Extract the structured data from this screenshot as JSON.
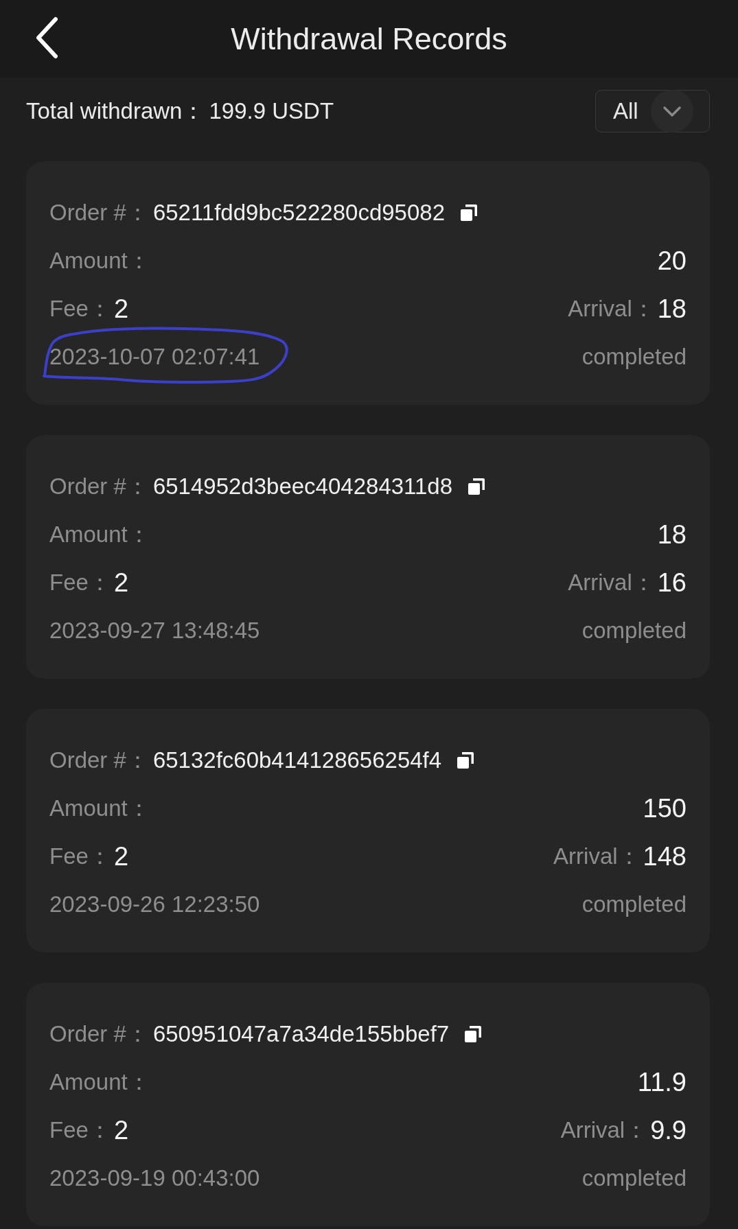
{
  "header": {
    "title": "Withdrawal Records"
  },
  "summary": {
    "label": "Total withdrawn：",
    "value": "199.9 USDT"
  },
  "filter": {
    "value": "All"
  },
  "records": [
    {
      "order_label": "Order #：",
      "order_no": "65211fdd9bc522280cd95082",
      "amount_label": "Amount：",
      "amount": "20",
      "fee_label": "Fee：",
      "fee": "2",
      "arrival_label": "Arrival：",
      "arrival": "18",
      "time": "2023-10-07 02:07:41",
      "status": "completed",
      "circled": true
    },
    {
      "order_label": "Order #：",
      "order_no": "6514952d3beec404284311d8",
      "amount_label": "Amount：",
      "amount": "18",
      "fee_label": "Fee：",
      "fee": "2",
      "arrival_label": "Arrival：",
      "arrival": "16",
      "time": "2023-09-27 13:48:45",
      "status": "completed",
      "circled": false
    },
    {
      "order_label": "Order #：",
      "order_no": "65132fc60b414128656254f4",
      "amount_label": "Amount：",
      "amount": "150",
      "fee_label": "Fee：",
      "fee": "2",
      "arrival_label": "Arrival：",
      "arrival": "148",
      "time": "2023-09-26 12:23:50",
      "status": "completed",
      "circled": false
    },
    {
      "order_label": "Order #：",
      "order_no": "650951047a7a34de155bbef7",
      "amount_label": "Amount：",
      "amount": "11.9",
      "fee_label": "Fee：",
      "fee": "2",
      "arrival_label": "Arrival：",
      "arrival": "9.9",
      "time": "2023-09-19 00:43:00",
      "status": "completed",
      "circled": false
    }
  ]
}
